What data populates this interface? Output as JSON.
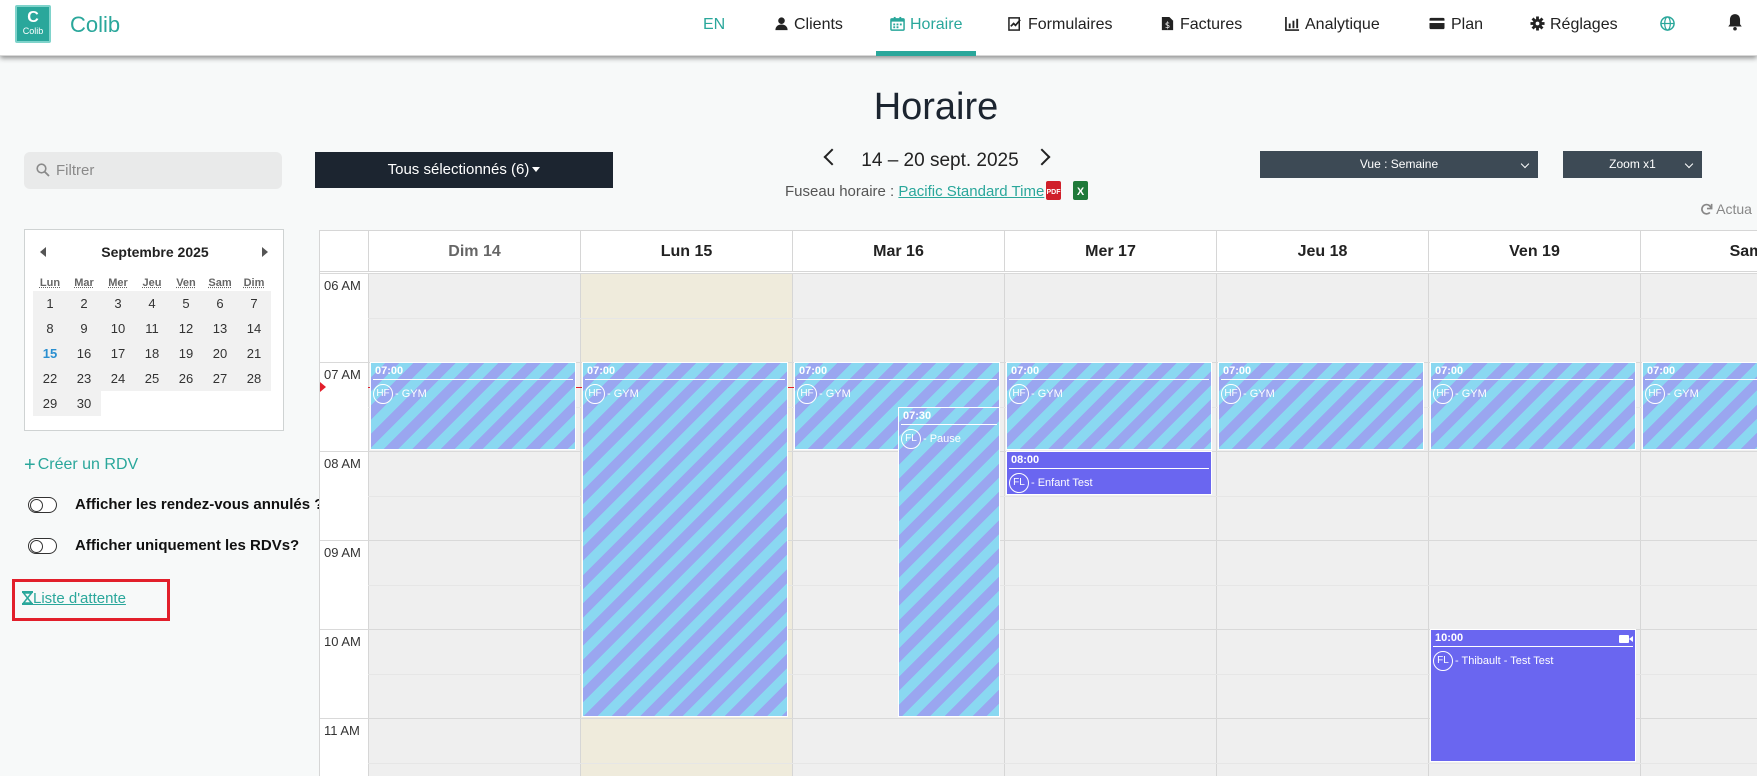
{
  "brand": {
    "logo_mark": "C",
    "logo_word": "Colib",
    "name": "Colib"
  },
  "nav": {
    "lang": "EN",
    "items": [
      {
        "label": "Clients",
        "icon": "user-icon"
      },
      {
        "label": "Horaire",
        "icon": "calendar-icon",
        "active": true
      },
      {
        "label": "Formulaires",
        "icon": "form-icon"
      },
      {
        "label": "Factures",
        "icon": "invoice-icon"
      },
      {
        "label": "Analytique",
        "icon": "chart-icon"
      },
      {
        "label": "Plan",
        "icon": "credit-card-icon"
      },
      {
        "label": "Réglages",
        "icon": "gear-icon"
      }
    ],
    "extra_icons": [
      "globe-icon",
      "bell-icon"
    ]
  },
  "page": {
    "title": "Horaire"
  },
  "sidebar": {
    "filter_placeholder": "Filtrer",
    "minical": {
      "month_label": "Septembre 2025",
      "weekdays": [
        "Lun",
        "Mar",
        "Mer",
        "Jeu",
        "Ven",
        "Sam",
        "Dim"
      ],
      "weeks": [
        [
          "1",
          "2",
          "3",
          "4",
          "5",
          "6",
          "7"
        ],
        [
          "8",
          "9",
          "10",
          "11",
          "12",
          "13",
          "14"
        ],
        [
          "15",
          "16",
          "17",
          "18",
          "19",
          "20",
          "21"
        ],
        [
          "22",
          "23",
          "24",
          "25",
          "26",
          "27",
          "28"
        ],
        [
          "29",
          "30",
          "",
          "",
          "",
          "",
          ""
        ]
      ],
      "today": "15"
    },
    "create_label": "Créer un RDV",
    "toggle_cancelled": "Afficher les rendez-vous annulés ?",
    "toggle_only_rdv": "Afficher uniquement les RDVs?",
    "waitlist_label": "Liste d'attente"
  },
  "toolbar": {
    "select_all": "Tous sélectionnés (6)",
    "date_range": "14 – 20 sept. 2025",
    "tz_label": "Fuseau horaire :",
    "tz_value": "Pacific Standard Time",
    "pdf_label": "PDF",
    "xls_label": "X",
    "view_select": "Vue : Semaine",
    "zoom_select": "Zoom x1",
    "refresh_label": "Actua"
  },
  "calendar": {
    "days": [
      "Dim 14",
      "Lun 15",
      "Mar 16",
      "Mer 17",
      "Jeu 18",
      "Ven 19",
      "Sam"
    ],
    "times": [
      "06 AM",
      "07 AM",
      "08 AM",
      "09 AM",
      "10 AM",
      "11 AM"
    ],
    "colors": {
      "stripe_a": "#8ad8f1",
      "stripe_b": "#9aa6f0",
      "solid": "#6a66f0",
      "today_bg": "#efebdc",
      "now_line": "#e21f2b"
    },
    "events": [
      {
        "day": 0,
        "start": "07:00",
        "initials": "HF",
        "title": "- GYM",
        "style": "stripe"
      },
      {
        "day": 1,
        "start": "07:00",
        "initials": "HF",
        "title": "- GYM",
        "style": "stripe"
      },
      {
        "day": 2,
        "start": "07:00",
        "initials": "HF",
        "title": "- GYM",
        "style": "stripe"
      },
      {
        "day": 2,
        "start": "07:30",
        "initials": "FL",
        "title": "- Pause",
        "style": "stripe"
      },
      {
        "day": 3,
        "start": "07:00",
        "initials": "HF",
        "title": "- GYM",
        "style": "stripe"
      },
      {
        "day": 3,
        "start": "08:00",
        "initials": "FL",
        "title": "- Enfant Test",
        "style": "solid"
      },
      {
        "day": 4,
        "start": "07:00",
        "initials": "HF",
        "title": "- GYM",
        "style": "stripe"
      },
      {
        "day": 5,
        "start": "07:00",
        "initials": "HF",
        "title": "- GYM",
        "style": "stripe"
      },
      {
        "day": 5,
        "start": "10:00",
        "initials": "FL",
        "title": "- Thibault - Test Test",
        "style": "solid",
        "video": true
      },
      {
        "day": 6,
        "start": "07:00",
        "initials": "HF",
        "title": "- GYM",
        "style": "stripe"
      }
    ]
  }
}
